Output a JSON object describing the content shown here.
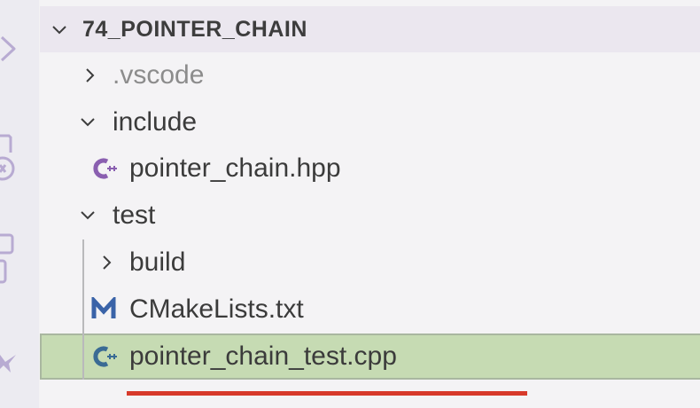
{
  "explorer": {
    "folder_title": "74_POINTER_CHAIN",
    "items": [
      {
        "label": ".vscode",
        "kind": "folder",
        "expanded": false
      },
      {
        "label": "include",
        "kind": "folder",
        "expanded": true
      },
      {
        "label": "pointer_chain.hpp",
        "kind": "file",
        "icon": "cpp-icon"
      },
      {
        "label": "test",
        "kind": "folder",
        "expanded": true
      },
      {
        "label": "build",
        "kind": "folder",
        "expanded": false
      },
      {
        "label": "CMakeLists.txt",
        "kind": "file",
        "icon": "cmake-icon"
      },
      {
        "label": "pointer_chain_test.cpp",
        "kind": "file",
        "icon": "cpp-icon",
        "selected": true
      }
    ]
  },
  "colors": {
    "selected_bg": "#c6dbb3",
    "cpp_icon": "#8a5fb0",
    "cmake_icon": "#3a63a8",
    "annotation_underline": "#d73a2b"
  }
}
